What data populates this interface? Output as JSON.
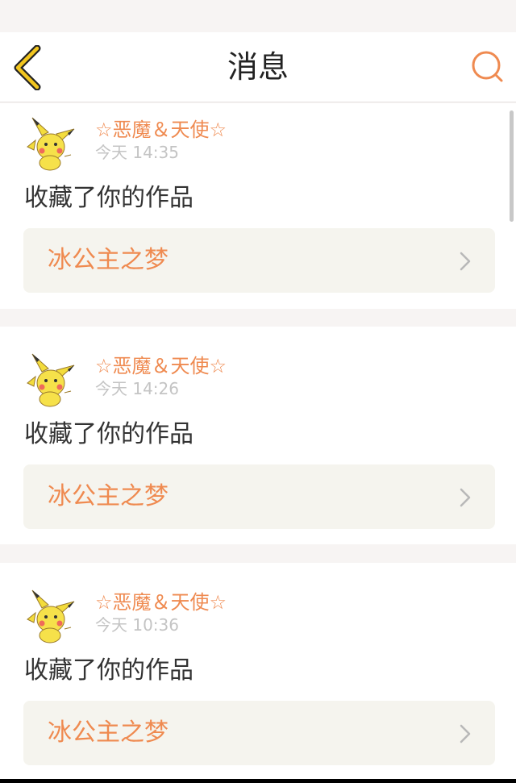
{
  "header": {
    "title": "消息",
    "back_icon": "chevron-left-icon",
    "search_icon": "search-icon"
  },
  "colors": {
    "accent": "#ef8a50",
    "nav_icon": "#e8c020",
    "card_link_bg": "#f5f4ee",
    "page_bg": "#f7f4f3"
  },
  "messages": [
    {
      "username": "☆恶魔＆天使☆",
      "time": "今天 14:35",
      "action": "收藏了你的作品",
      "work_title": "冰公主之梦",
      "avatar": "pikachu-avatar"
    },
    {
      "username": "☆恶魔＆天使☆",
      "time": "今天 14:26",
      "action": "收藏了你的作品",
      "work_title": "冰公主之梦",
      "avatar": "pikachu-avatar"
    },
    {
      "username": "☆恶魔＆天使☆",
      "time": "今天 10:36",
      "action": "收藏了你的作品",
      "work_title": "冰公主之梦",
      "avatar": "pikachu-avatar"
    }
  ]
}
